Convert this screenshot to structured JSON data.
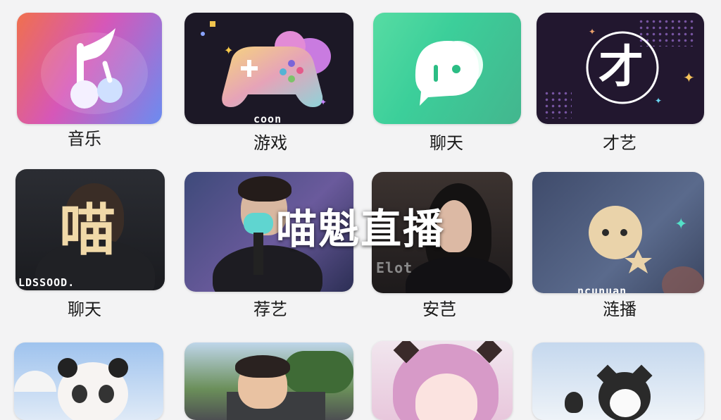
{
  "tiles": [
    {
      "label": "音乐",
      "icon": "music-note-icon"
    },
    {
      "label": "游戏",
      "icon": "gamepad-icon"
    },
    {
      "label": "聊天",
      "icon": "chat-bubble-icon"
    },
    {
      "label": "才艺",
      "icon": "talent-icon",
      "glyph": "才"
    },
    {
      "label": "聊天",
      "icon": "portrait-photo",
      "glyph": "喵"
    },
    {
      "label": "荐艺",
      "icon": "microphone-photo"
    },
    {
      "label": "安芑",
      "icon": "portrait-photo"
    },
    {
      "label": "涟播",
      "icon": "emoji-face-icon"
    },
    {
      "label": "",
      "icon": "panda-photo"
    },
    {
      "label": "",
      "icon": "cartoon-boy-photo"
    },
    {
      "label": "",
      "icon": "anime-girl-photo"
    },
    {
      "label": "",
      "icon": "cat-photo"
    }
  ],
  "overlay": {
    "title": "喵魁直播"
  },
  "garbled": {
    "t5": "LDSSOOD.",
    "t8": "ncunuan",
    "t7": "Elot",
    "t2": "coon"
  },
  "colors": {
    "background": "#f3f3f4",
    "music_grad_start": "#f0704d",
    "music_grad_end": "#6b8cf0",
    "chat_green": "#3ccf9a",
    "dark_tile": "#1c1826"
  }
}
